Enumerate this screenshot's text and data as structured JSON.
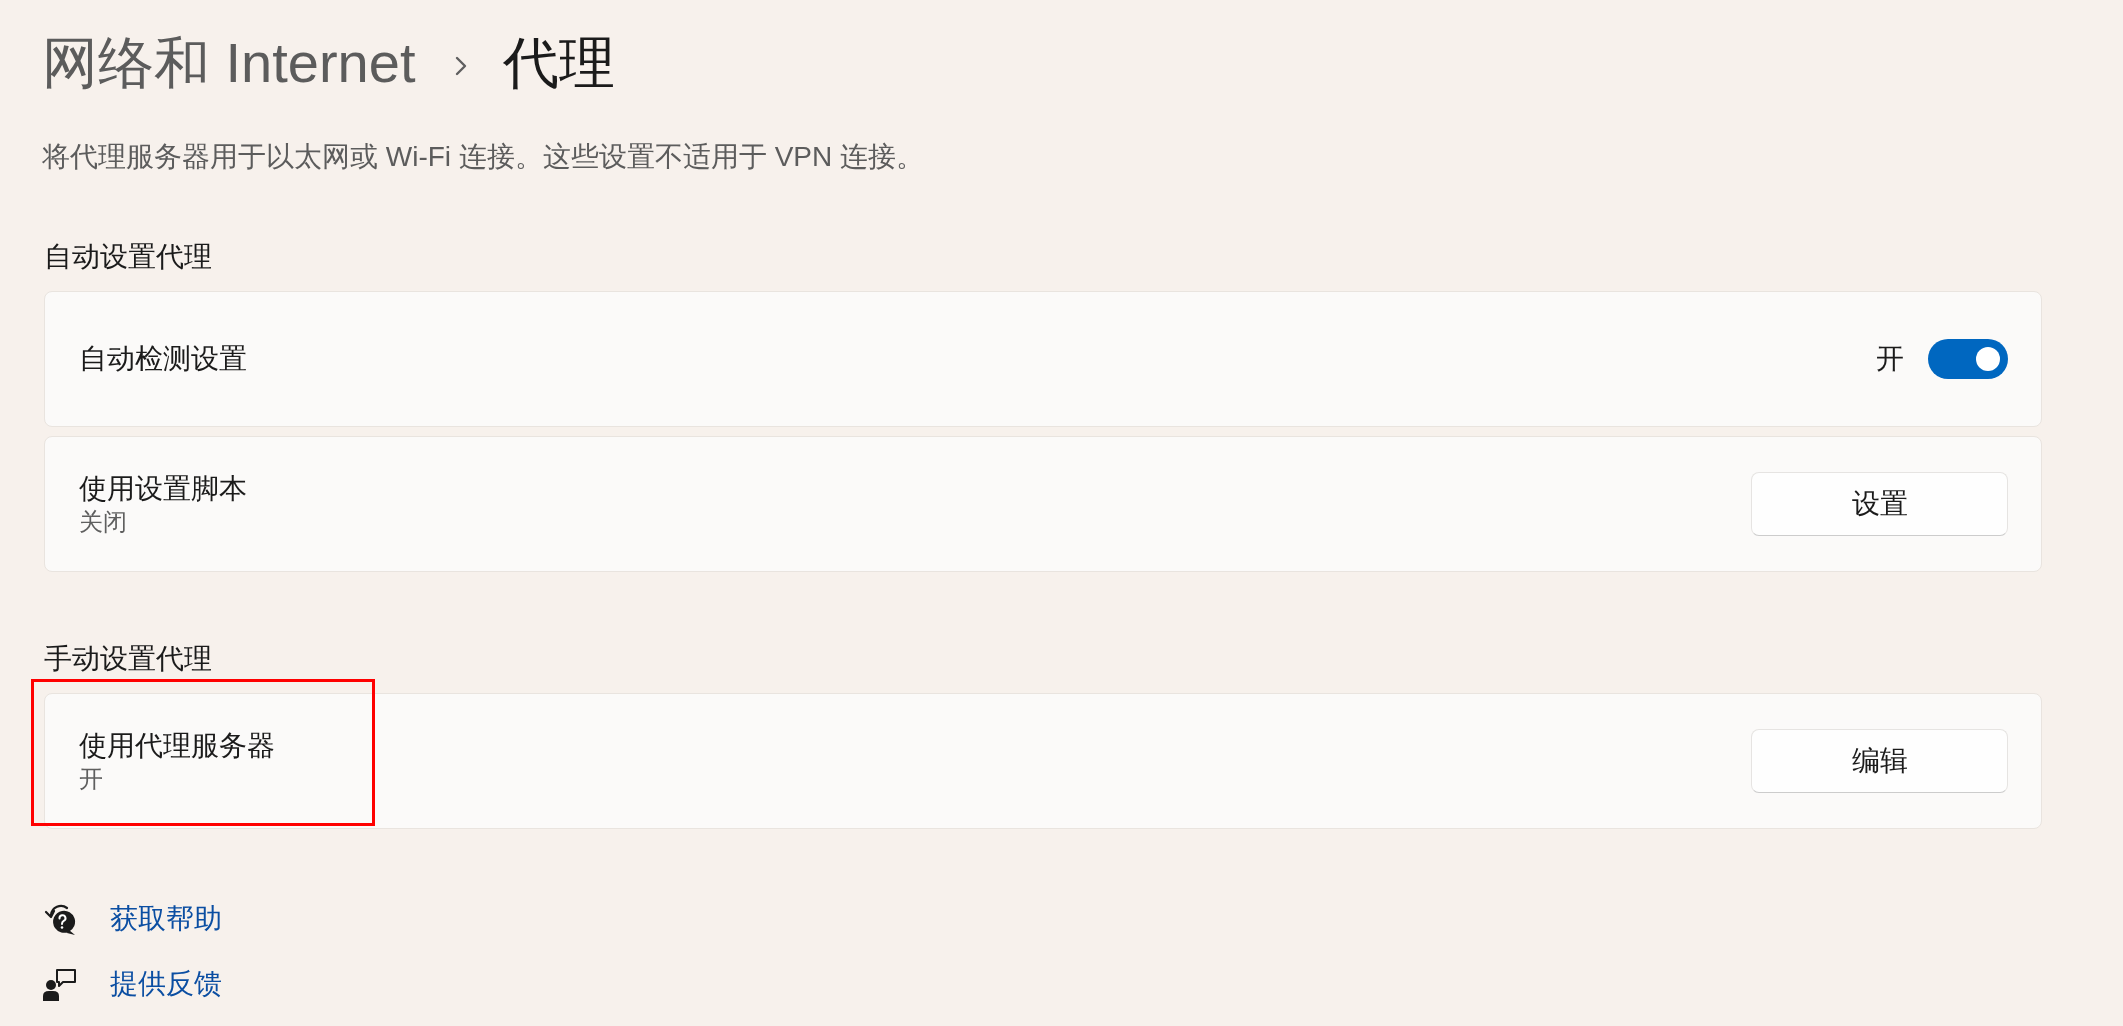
{
  "breadcrumb": [
    {
      "label": "网络和 Internet",
      "current": false
    },
    {
      "label": "代理",
      "current": true
    }
  ],
  "description": "将代理服务器用于以太网或 Wi-Fi 连接。这些设置不适用于 VPN 连接。",
  "sections": [
    {
      "heading": "自动设置代理",
      "rows": [
        {
          "kind": "toggle",
          "title": "自动检测设置",
          "state_label": "开",
          "on": true,
          "highlighted": false
        },
        {
          "kind": "button",
          "title": "使用设置脚本",
          "subtitle": "关闭",
          "button": "设置",
          "highlighted": false
        }
      ]
    },
    {
      "heading": "手动设置代理",
      "rows": [
        {
          "kind": "button",
          "title": "使用代理服务器",
          "subtitle": "开",
          "button": "编辑",
          "highlighted": true
        }
      ]
    }
  ],
  "links": [
    {
      "kind": "help",
      "label": "获取帮助"
    },
    {
      "kind": "feedback",
      "label": "提供反馈"
    }
  ]
}
